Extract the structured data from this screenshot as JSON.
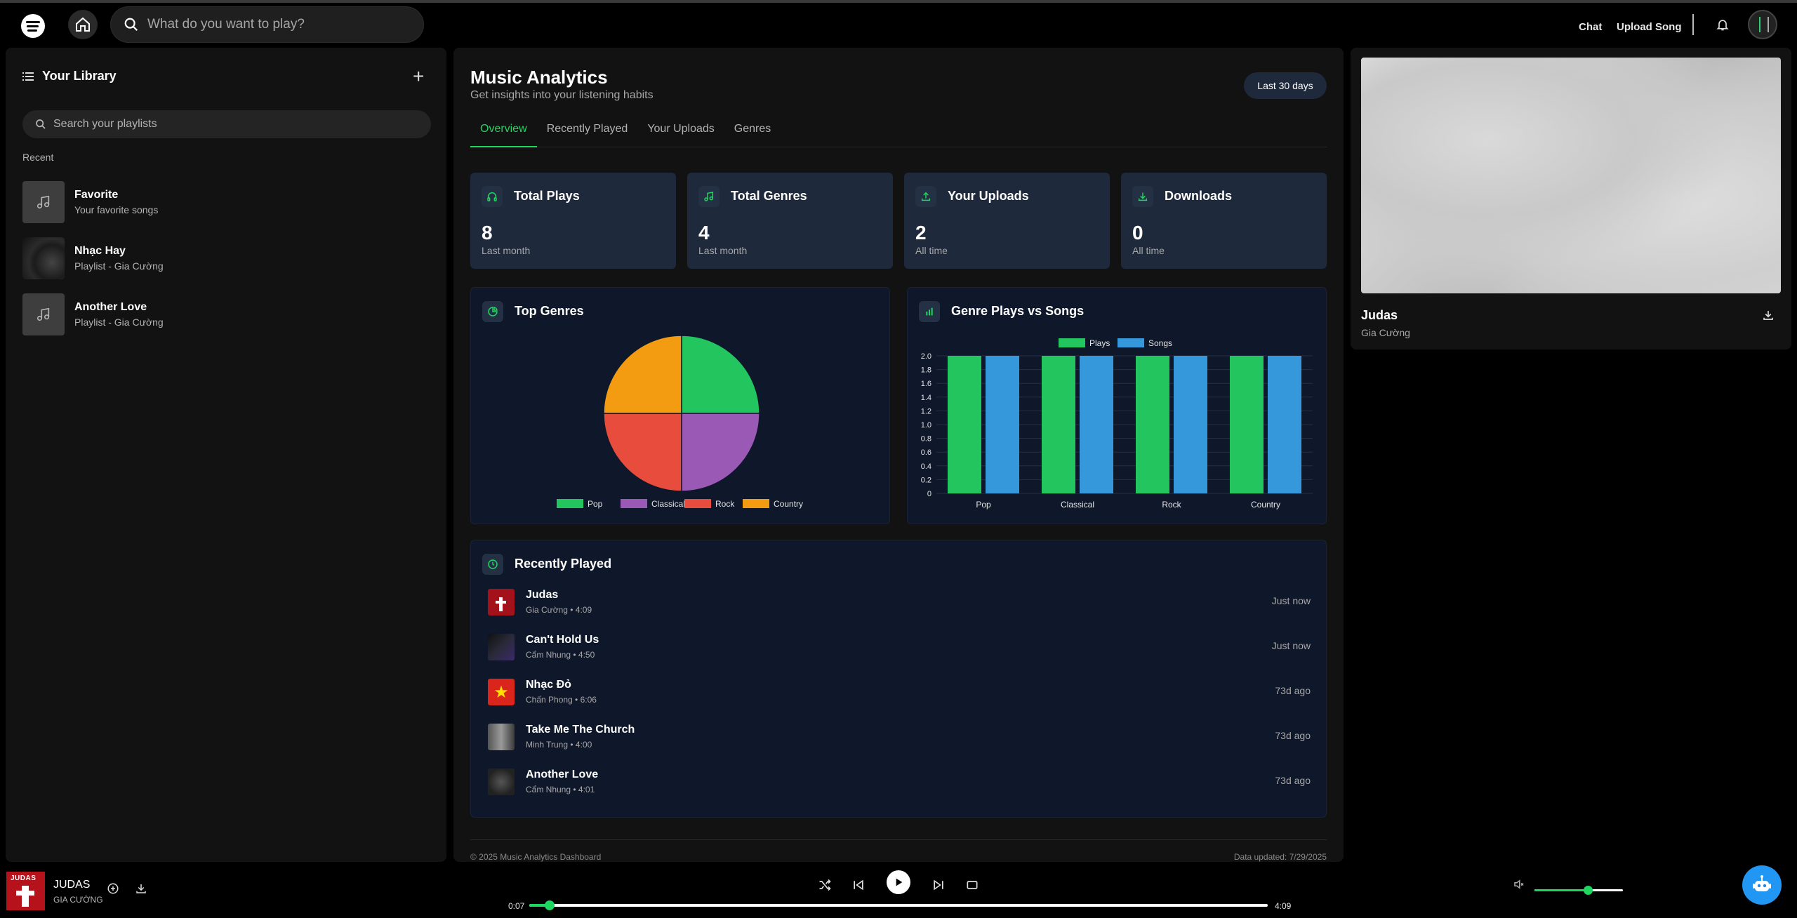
{
  "header": {
    "search_placeholder": "What do you want to play?",
    "chat_label": "Chat",
    "upload_label": "Upload Song"
  },
  "library": {
    "title": "Your Library",
    "search_placeholder": "Search your playlists",
    "recent_label": "Recent",
    "playlists": [
      {
        "name": "Favorite",
        "sub": "Your favorite songs"
      },
      {
        "name": "Nhạc Hay",
        "sub": "Playlist - Gia Cường"
      },
      {
        "name": "Another Love",
        "sub": "Playlist - Gia Cường"
      }
    ]
  },
  "main": {
    "title": "Music Analytics",
    "subtitle": "Get insights into your listening habits",
    "range_button": "Last 30 days",
    "tabs": [
      "Overview",
      "Recently Played",
      "Your Uploads",
      "Genres"
    ],
    "stats": [
      {
        "title": "Total Plays",
        "value": "8",
        "sub": "Last month",
        "icon": "headphones-icon"
      },
      {
        "title": "Total Genres",
        "value": "4",
        "sub": "Last month",
        "icon": "music-note-icon"
      },
      {
        "title": "Your Uploads",
        "value": "2",
        "sub": "All time",
        "icon": "upload-icon"
      },
      {
        "title": "Downloads",
        "value": "0",
        "sub": "All time",
        "icon": "download-icon"
      }
    ],
    "top_genres_title": "Top Genres",
    "genre_chart_title": "Genre Plays vs Songs",
    "recent_title": "Recently Played",
    "recent": [
      {
        "name": "Judas",
        "sub": "Gia Cường • 4:09",
        "time": "Just now"
      },
      {
        "name": "Can't Hold Us",
        "sub": "Cẩm Nhung • 4:50",
        "time": "Just now"
      },
      {
        "name": "Nhạc Đỏ",
        "sub": "Chấn Phong • 6:06",
        "time": "73d ago"
      },
      {
        "name": "Take Me The Church",
        "sub": "Minh Trung • 4:00",
        "time": "73d ago"
      },
      {
        "name": "Another Love",
        "sub": "Cẩm Nhung • 4:01",
        "time": "73d ago"
      }
    ],
    "footer_left": "© 2025 Music Analytics Dashboard",
    "footer_right": "Data updated: 7/29/2025"
  },
  "colors": {
    "accent": "#1ed760",
    "pop": "#22c55e",
    "classical": "#9b59b6",
    "rock": "#e74c3c",
    "country": "#f39c12",
    "songs": "#3498db"
  },
  "chart_data": [
    {
      "type": "pie",
      "title": "Top Genres",
      "categories": [
        "Pop",
        "Classical",
        "Rock",
        "Country"
      ],
      "values": [
        1,
        1,
        1,
        1
      ],
      "colors": [
        "#22c55e",
        "#9b59b6",
        "#e74c3c",
        "#f39c12"
      ],
      "legend": "bottom"
    },
    {
      "type": "bar",
      "title": "Genre Plays vs Songs",
      "categories": [
        "Pop",
        "Classical",
        "Rock",
        "Country"
      ],
      "series": [
        {
          "name": "Plays",
          "values": [
            2,
            2,
            2,
            2
          ],
          "color": "#22c55e"
        },
        {
          "name": "Songs",
          "values": [
            2,
            2,
            2,
            2
          ],
          "color": "#3498db"
        }
      ],
      "ylim": [
        0,
        2.0
      ],
      "yticks": [
        "0",
        "0.2",
        "0.4",
        "0.6",
        "0.8",
        "1.0",
        "1.2",
        "1.4",
        "1.6",
        "1.8",
        "2.0"
      ],
      "legend": "top",
      "grid": true
    }
  ],
  "now_playing_panel": {
    "title": "Judas",
    "artist": "Gia Cường"
  },
  "player": {
    "cover_text": "JUDAS",
    "title": "JUDAS",
    "artist": "GIA CƯỜNG",
    "elapsed": "0:07",
    "duration": "4:09",
    "progress": 0.028,
    "volume": 0.6
  }
}
